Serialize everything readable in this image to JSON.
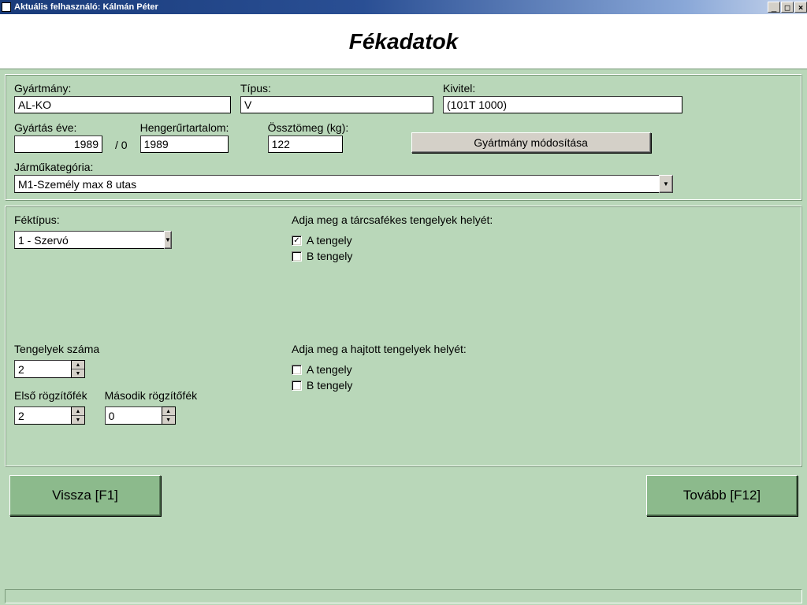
{
  "window": {
    "title": "Aktuális felhasználó: Kálmán Péter"
  },
  "page_title": "Fékadatok",
  "form": {
    "gyartmany": {
      "label": "Gyártmány:",
      "value": "AL-KO"
    },
    "tipus": {
      "label": "Típus:",
      "value": "V"
    },
    "kivitel": {
      "label": "Kivitel:",
      "value": "(101T 1000)"
    },
    "gyartas_eve": {
      "label": "Gyártás éve:",
      "value": "1989",
      "suffix": "/  0"
    },
    "hengerur": {
      "label": "Hengerűrtartalom:",
      "value": "1989"
    },
    "ossztomeg": {
      "label": "Össztömeg (kg):",
      "value": "122"
    },
    "modositas_btn": "Gyártmány módosítása",
    "jarmukat": {
      "label": "Járműkategória:",
      "value": "M1-Személy max 8 utas"
    },
    "fektipus": {
      "label": "Féktípus:",
      "value": "1 - Szervó"
    },
    "tarcsafek": {
      "label": "Adja meg a tárcsafékes tengelyek helyét:",
      "a": {
        "label": "A tengely",
        "checked": true
      },
      "b": {
        "label": "B tengely",
        "checked": false
      }
    },
    "tengelyek": {
      "label": "Tengelyek száma",
      "value": "2"
    },
    "hajtott": {
      "label": "Adja meg a hajtott tengelyek helyét:",
      "a": {
        "label": "A tengely",
        "checked": false
      },
      "b": {
        "label": "B tengely",
        "checked": false
      }
    },
    "rogzito1": {
      "label": "Első rögzítőfék",
      "value": "2"
    },
    "rogzito2": {
      "label": "Második rögzítőfék",
      "value": "0"
    }
  },
  "buttons": {
    "back": "Vissza [F1]",
    "next": "Tovább [F12]"
  }
}
